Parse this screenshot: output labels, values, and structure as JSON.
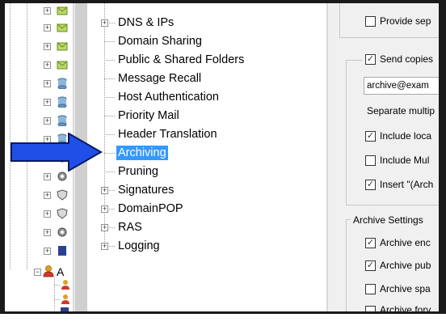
{
  "mid_tree": {
    "items": [
      {
        "label": "DNS & IPs",
        "expandable": true
      },
      {
        "label": "Domain Sharing",
        "expandable": false
      },
      {
        "label": "Public & Shared Folders",
        "expandable": false
      },
      {
        "label": "Message Recall",
        "expandable": false
      },
      {
        "label": "Host Authentication",
        "expandable": false
      },
      {
        "label": "Priority Mail",
        "expandable": false
      },
      {
        "label": "Header Translation",
        "expandable": false
      },
      {
        "label": "Archiving",
        "expandable": false,
        "selected": true
      },
      {
        "label": "Pruning",
        "expandable": false
      },
      {
        "label": "Signatures",
        "expandable": true
      },
      {
        "label": "DomainPOP",
        "expandable": true
      },
      {
        "label": "RAS",
        "expandable": true
      },
      {
        "label": "Logging",
        "expandable": true
      }
    ]
  },
  "left_tree": {
    "partial_label": "A"
  },
  "right_panel": {
    "provide_sep_label": "Provide sep",
    "provide_sep_checked": false,
    "send_copies_label": "Send copies",
    "send_copies_checked": true,
    "archive_address_value": "archive@exam",
    "separate_multiple_label": "Separate multip",
    "include_local_label": "Include loca",
    "include_local_checked": true,
    "include_mul_label": "Include Mul",
    "include_mul_checked": false,
    "insert_arch_label": "Insert \"(Arch",
    "insert_arch_checked": true,
    "archive_settings_label": "Archive Settings",
    "archive_enc_label": "Archive enc",
    "archive_enc_checked": true,
    "archive_pub_label": "Archive pub",
    "archive_pub_checked": true,
    "archive_spa_label": "Archive spa",
    "archive_spa_checked": false,
    "archive_forv_label": "Archive forv",
    "archive_forv_checked": false
  },
  "annotation": {
    "arrow_color": "#1f4fe6",
    "arrow_target": "Archiving"
  },
  "colors": {
    "selection": "#3399ff",
    "mail_icon": "#8fbf3a",
    "user_icon": "#e0a020"
  }
}
